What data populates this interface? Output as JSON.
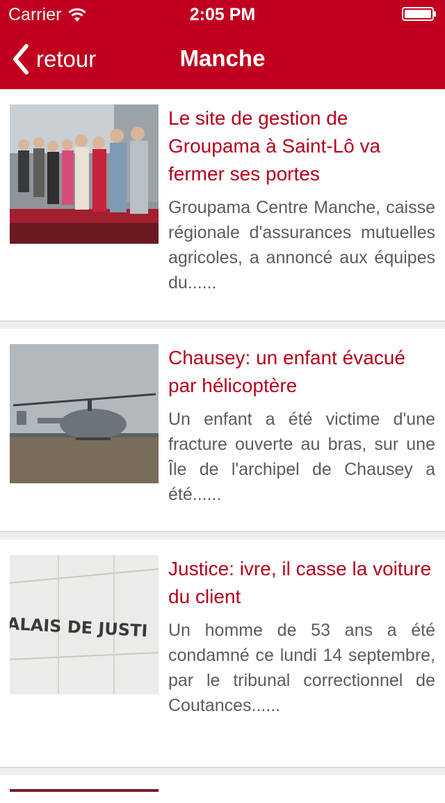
{
  "status_bar": {
    "carrier": "Carrier",
    "time": "2:05 PM"
  },
  "nav": {
    "back_label": "retour",
    "title": "Manche"
  },
  "colors": {
    "brand": "#c1001f",
    "title_text": "#b5001c",
    "body_text": "#5c5c5c"
  },
  "articles": [
    {
      "title": "Le site de gestion de Groupama à Saint-Lô va fermer ses portes",
      "excerpt": "Groupama Centre Manche, caisse régionale d'assurances mutuelles agricoles, a annoncé aux équipes du......",
      "image": "group-photo"
    },
    {
      "title": "Chausey: un enfant évacué par hélicoptère",
      "excerpt": "Un enfant a été victime d'une fracture ouverte au bras, sur une Île de l'archipel de Chausey a été......",
      "image": "helicopter-photo"
    },
    {
      "title": "Justice: ivre, il casse la voiture du client",
      "excerpt": "Un homme de 53 ans a été condamné ce lundi 14 septembre, par le tribunal correctionnel de Coutances......",
      "image": "courthouse-photo",
      "image_text": "ALAIS DE JUSTI"
    }
  ]
}
